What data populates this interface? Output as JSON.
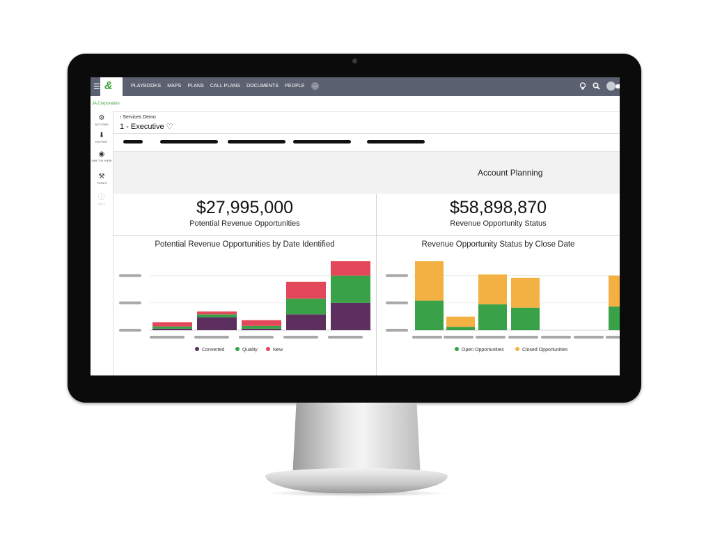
{
  "nav": {
    "logo": "&",
    "items": [
      "PLAYBOOKS",
      "MAPS",
      "PLANS",
      "CALL PLANS",
      "DOCUMENTS",
      "PEOPLE"
    ],
    "more": "…"
  },
  "corp": "JA Corporation",
  "sidebar": {
    "actions": "ACTIONS",
    "export": "EXPORT",
    "switch_view": "SWITCH VIEW",
    "tools": "TOOLS",
    "help": "HELP"
  },
  "breadcrumb": {
    "parent": "Services Demo",
    "title": "1 - Executive"
  },
  "banner": {
    "title": "Account Planning"
  },
  "kpis": [
    {
      "value": "$27,995,000",
      "label": "Potential Revenue Opportunities"
    },
    {
      "value": "$58,898,870",
      "label": "Revenue Opportunity Status"
    }
  ],
  "colors": {
    "nav": "#5b6170",
    "purple": "#5c2f5e",
    "red": "#e2475a",
    "green": "#39a148",
    "orange": "#f2b142",
    "accent_green": "#3aa33a"
  },
  "chart_data": [
    {
      "type": "bar",
      "stacked": true,
      "title": "Potential Revenue Opportunities by Date Identified",
      "categories": [
        "",
        "",
        "",
        "",
        ""
      ],
      "series": [
        {
          "name": "Converted",
          "color": "#5c2f5e",
          "values": [
            0.5,
            4.5,
            0.5,
            5.5,
            9.5
          ]
        },
        {
          "name": "Quality",
          "color": "#39a148",
          "values": [
            0.8,
            1.0,
            1.0,
            5.5,
            9.5
          ]
        },
        {
          "name": "New",
          "color": "#e2475a",
          "values": [
            1.5,
            1.0,
            2.0,
            5.8,
            5.0
          ]
        }
      ],
      "legend": "bottom"
    },
    {
      "type": "bar",
      "stacked": true,
      "title": "Revenue Opportunity Status by Close Date",
      "categories": [
        "",
        "",
        "",
        "",
        "",
        "",
        ""
      ],
      "series": [
        {
          "name": "Open Opportunities",
          "color": "#39a148",
          "values": [
            10.5,
            1.2,
            9.2,
            8.0,
            0,
            0,
            8.4
          ]
        },
        {
          "name": "Closed Opportunities",
          "color": "#f2b142",
          "values": [
            14.0,
            3.6,
            10.6,
            10.6,
            0,
            0,
            11.0
          ]
        }
      ],
      "legend": "bottom"
    }
  ]
}
